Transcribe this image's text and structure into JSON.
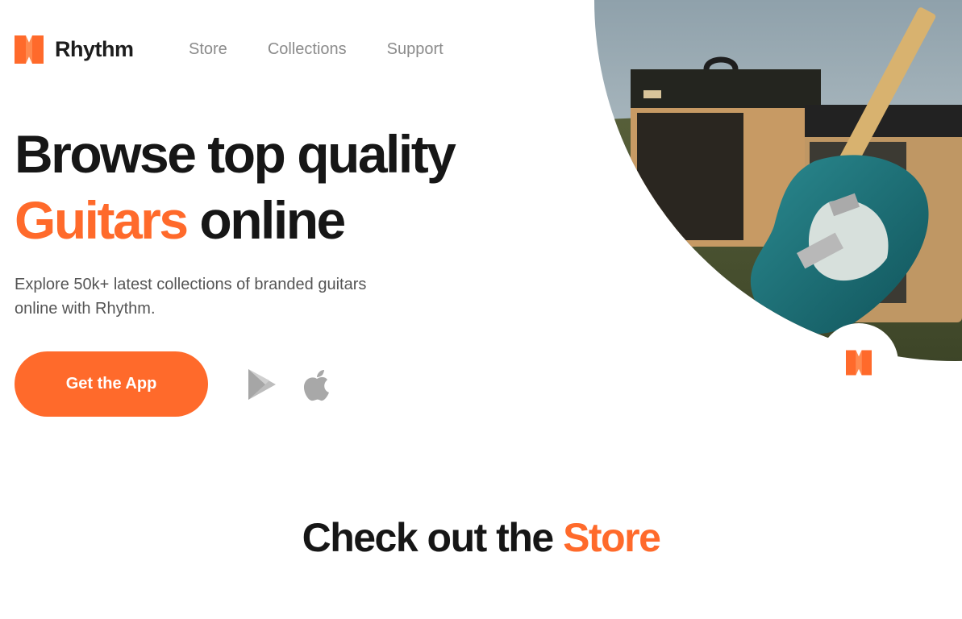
{
  "brand": {
    "name": "Rhythm",
    "logo_icon": "rhythm-logo-icon",
    "accent_color": "#ff6a2b",
    "text_color": "#161616"
  },
  "nav": {
    "items": [
      {
        "label": "Store"
      },
      {
        "label": "Collections"
      },
      {
        "label": "Support"
      }
    ]
  },
  "hero": {
    "headline_line1": "Browse top quality",
    "headline_accent": "Guitars",
    "headline_rest": " online",
    "subtitle_line1": "Explore 50k+ latest collections of branded guitars",
    "subtitle_line2": "online with Rhythm.",
    "cta_label": "Get the App",
    "store_icons": [
      "google-play-icon",
      "apple-icon"
    ],
    "image": "guitar-and-amplifiers-photo"
  },
  "section": {
    "title_prefix": "Check out the ",
    "title_accent": "Store"
  }
}
